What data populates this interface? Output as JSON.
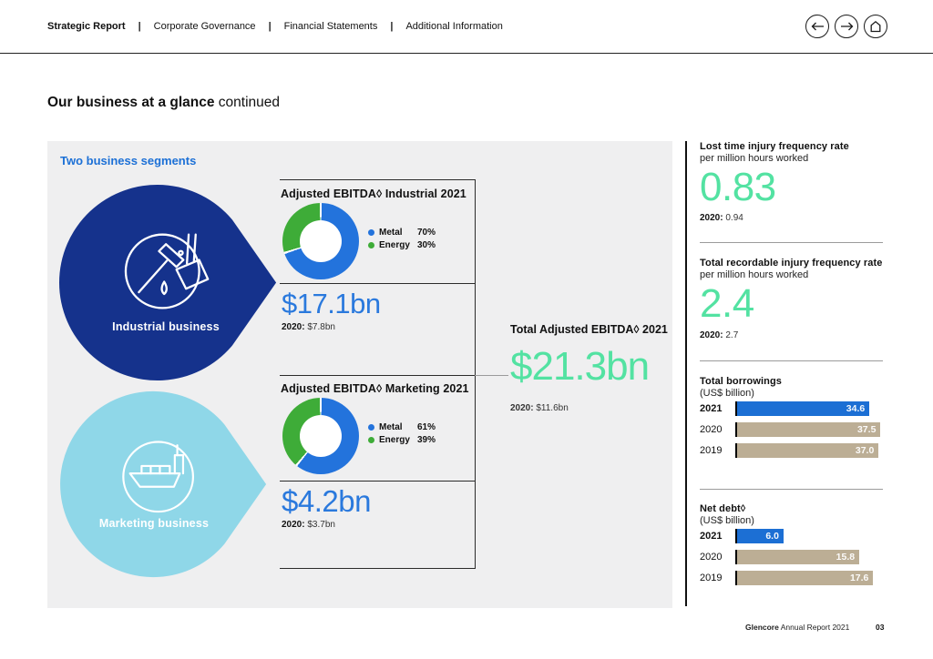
{
  "theme": {
    "navy": "#15328c",
    "lightblue": "#8fd7e8",
    "metal": "#2373dc",
    "energy": "#3eac38",
    "blue": "#1c6fd4",
    "tan": "#bcae95",
    "mint": "#53e2a2",
    "link": "#1c70d6",
    "panel": "#efeff0"
  },
  "nav": {
    "separator": "|",
    "tabs": [
      {
        "label": "Strategic Report",
        "active": true
      },
      {
        "label": "Corporate Governance",
        "active": false
      },
      {
        "label": "Financial Statements",
        "active": false
      },
      {
        "label": "Additional Information",
        "active": false
      }
    ],
    "icons": {
      "back": "arrow-left-icon",
      "forward": "arrow-right-icon",
      "home": "home-icon"
    }
  },
  "heading": {
    "bold": "Our business at a glance",
    "rest": "continued"
  },
  "main": {
    "panel_title": "Two business segments",
    "segments": [
      {
        "label": "Industrial business",
        "icon": "mining-hammer-ladle-icon"
      },
      {
        "label": "Marketing business",
        "icon": "cargo-ship-icon"
      }
    ],
    "industrial": {
      "title": "Adjusted EBITDA◊ Industrial 2021",
      "value": "$17.1bn",
      "prior_label": "2020:",
      "prior_value": "$7.8bn",
      "legend": [
        {
          "name": "Metal",
          "pct": 70,
          "pct_label": "70%"
        },
        {
          "name": "Energy",
          "pct": 30,
          "pct_label": "30%"
        }
      ]
    },
    "marketing": {
      "title": "Adjusted EBITDA◊ Marketing 2021",
      "value": "$4.2bn",
      "prior_label": "2020:",
      "prior_value": "$3.7bn",
      "legend": [
        {
          "name": "Metal",
          "pct": 61,
          "pct_label": "61%"
        },
        {
          "name": "Energy",
          "pct": 39,
          "pct_label": "39%"
        }
      ]
    },
    "total": {
      "title": "Total Adjusted EBITDA◊ 2021",
      "value": "$21.3bn",
      "prior_label": "2020:",
      "prior_value": "$11.6bn"
    }
  },
  "sidebar": {
    "stats": [
      {
        "title": "Lost time injury frequency rate",
        "subtitle": "per million hours worked",
        "value": "0.83",
        "prior_label": "2020:",
        "prior_value": "0.94"
      },
      {
        "title": "Total recordable injury frequency rate",
        "subtitle": "per million hours worked",
        "value": "2.4",
        "prior_label": "2020:",
        "prior_value": "2.7"
      }
    ],
    "bar_charts": [
      {
        "title": "Total borrowings",
        "subtitle": "(US$ billion)",
        "axis_max": 45.5,
        "bars": [
          {
            "year": "2021",
            "value": 34.6,
            "label": "34.6",
            "color": "blue"
          },
          {
            "year": "2020",
            "value": 37.5,
            "label": "37.5",
            "color": "tan"
          },
          {
            "year": "2019",
            "value": 37.0,
            "label": "37.0",
            "color": "tan"
          }
        ]
      },
      {
        "title": "Net debt◊",
        "subtitle": "(US$ billion)",
        "axis_max": 22.5,
        "bars": [
          {
            "year": "2021",
            "value": 6.0,
            "label": "6.0",
            "color": "blue"
          },
          {
            "year": "2020",
            "value": 15.8,
            "label": "15.8",
            "color": "tan"
          },
          {
            "year": "2019",
            "value": 17.6,
            "label": "17.6",
            "color": "tan"
          }
        ]
      }
    ]
  },
  "footer": {
    "brand": "Glencore",
    "rest": " Annual Report 2021",
    "page": "03"
  },
  "chart_data": [
    {
      "type": "pie",
      "title": "Adjusted EBITDA◊ Industrial 2021",
      "labels": [
        "Metal",
        "Energy"
      ],
      "values": [
        70,
        30
      ],
      "unit": "%",
      "center_total": "$17.1bn",
      "prior_2020": "$7.8bn",
      "colors": [
        "#2373dc",
        "#3eac38"
      ],
      "legend_position": "right"
    },
    {
      "type": "pie",
      "title": "Adjusted EBITDA◊ Marketing 2021",
      "labels": [
        "Metal",
        "Energy"
      ],
      "values": [
        61,
        39
      ],
      "unit": "%",
      "center_total": "$4.2bn",
      "prior_2020": "$3.7bn",
      "colors": [
        "#2373dc",
        "#3eac38"
      ],
      "legend_position": "right"
    },
    {
      "type": "bar",
      "orientation": "horizontal",
      "title": "Total borrowings",
      "xlabel": "(US$ billion)",
      "categories": [
        "2021",
        "2020",
        "2019"
      ],
      "values": [
        34.6,
        37.5,
        37.0
      ],
      "xlim": [
        0,
        45.5
      ],
      "colors": [
        "#1c6fd4",
        "#bcae95",
        "#bcae95"
      ]
    },
    {
      "type": "bar",
      "orientation": "horizontal",
      "title": "Net debt◊",
      "xlabel": "(US$ billion)",
      "categories": [
        "2021",
        "2020",
        "2019"
      ],
      "values": [
        6.0,
        15.8,
        17.6
      ],
      "xlim": [
        0,
        22.5
      ],
      "colors": [
        "#1c6fd4",
        "#bcae95",
        "#bcae95"
      ]
    }
  ]
}
